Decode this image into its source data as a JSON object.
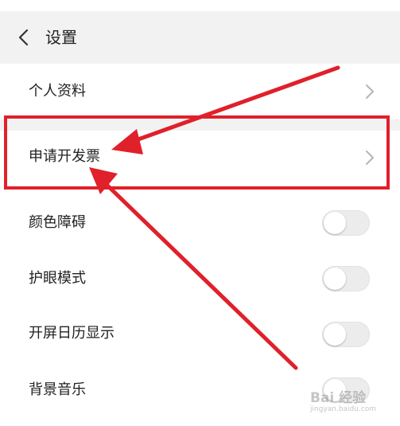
{
  "header": {
    "title": "设置"
  },
  "settings": {
    "profile": "个人资料",
    "invoice": "申请开发票",
    "color_blind": {
      "label": "颜色障碍",
      "on": false
    },
    "eye_care": {
      "label": "护眼模式",
      "on": false
    },
    "calendar": {
      "label": "开屏日历显示",
      "on": false
    },
    "music": {
      "label": "背景音乐",
      "on": false
    }
  },
  "icons": {
    "back": "chevron-left-icon",
    "chevron": "chevron-right-icon"
  },
  "colors": {
    "accent_annotation": "#e0202a",
    "header_bg": "#f2f2f2"
  },
  "watermark": {
    "main": "Bai 经验",
    "sub": "jingyan.baidu.com"
  }
}
